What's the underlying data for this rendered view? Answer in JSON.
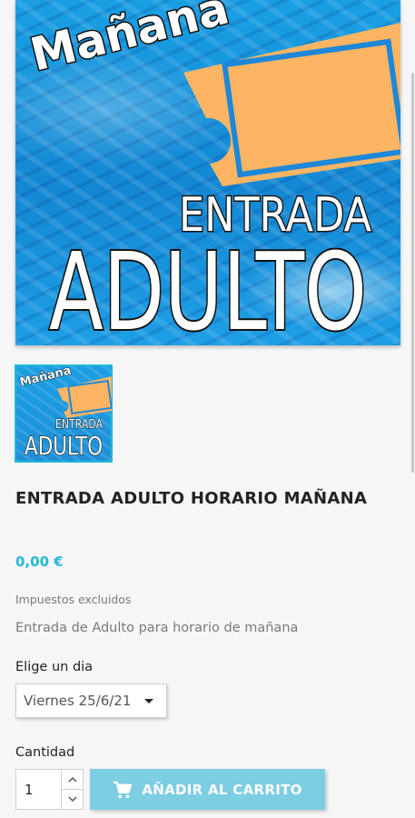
{
  "product": {
    "image": {
      "word_top": "Mañana",
      "word_mid": "ENTRADA",
      "word_big": "ADULTO",
      "ticket_color": "#FDB563",
      "water_color": "#1A9FE3"
    },
    "title": "ENTRADA ADULTO HORARIO MAÑANA",
    "price": "0,00 €",
    "tax_note": "Impuestos excluidos",
    "description": "Entrada de Adulto para horario de mañana"
  },
  "variant": {
    "label": "Elige un dia",
    "selected": "Viernes 25/6/21"
  },
  "quantity": {
    "label": "Cantidad",
    "value": "1"
  },
  "cart_button": {
    "label": "AÑADIR AL CARRITO",
    "icon": "cart-icon",
    "color": "#7DCDE3"
  },
  "accent_color": "#24B9D7"
}
